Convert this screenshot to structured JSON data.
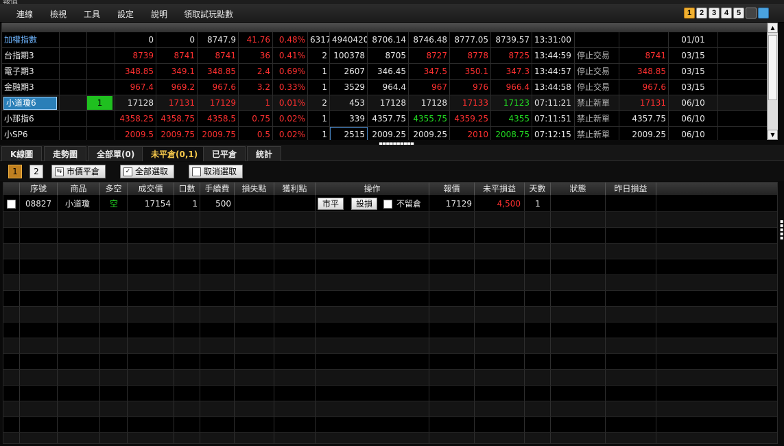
{
  "window": {
    "title": "報價"
  },
  "menu": [
    "連線",
    "檢視",
    "工具",
    "設定",
    "說明",
    "領取試玩點數"
  ],
  "layout_buttons": [
    "1",
    "2",
    "3",
    "4",
    "5"
  ],
  "quote": {
    "rows": [
      {
        "name": "加權指數",
        "c2": "",
        "c3": "",
        "bid": "0",
        "ask": "0",
        "last": "8747.9",
        "chg": "41.76",
        "pct": "0.48%",
        "vol": "6317",
        "total": "4940420",
        "ref": "8706.14",
        "open": "8746.48",
        "high": "8777.05",
        "low": "8739.57",
        "time": "13:31:00",
        "status": "",
        "settle": "",
        "date": "01/01"
      },
      {
        "name": "台指期3",
        "c2": "",
        "c3": "",
        "bid": "8739",
        "ask": "8741",
        "last": "8741",
        "chg": "36",
        "pct": "0.41%",
        "vol": "2",
        "total": "100378",
        "ref": "8705",
        "open": "8727",
        "high": "8778",
        "low": "8725",
        "time": "13:44:59",
        "status": "停止交易",
        "settle": "8741",
        "date": "03/15"
      },
      {
        "name": "電子期3",
        "c2": "",
        "c3": "",
        "bid": "348.85",
        "ask": "349.1",
        "last": "348.85",
        "chg": "2.4",
        "pct": "0.69%",
        "vol": "1",
        "total": "2607",
        "ref": "346.45",
        "open": "347.5",
        "high": "350.1",
        "low": "347.3",
        "time": "13:44:57",
        "status": "停止交易",
        "settle": "348.85",
        "date": "03/15"
      },
      {
        "name": "金融期3",
        "c2": "",
        "c3": "",
        "bid": "967.4",
        "ask": "969.2",
        "last": "967.6",
        "chg": "3.2",
        "pct": "0.33%",
        "vol": "1",
        "total": "3529",
        "ref": "964.4",
        "open": "967",
        "high": "976",
        "low": "966.4",
        "time": "13:44:58",
        "status": "停止交易",
        "settle": "967.6",
        "date": "03/15"
      },
      {
        "name": "小道瓊6",
        "c2": "",
        "c3": "1",
        "bid": "17128",
        "ask": "17131",
        "last": "17129",
        "chg": "1",
        "pct": "0.01%",
        "vol": "2",
        "total": "453",
        "ref": "17128",
        "open": "17128",
        "high": "17133",
        "low": "17123",
        "time": "07:11:21",
        "status": "禁止新單",
        "settle": "17131",
        "date": "06/10"
      },
      {
        "name": "小那指6",
        "c2": "",
        "c3": "",
        "bid": "4358.25",
        "ask": "4358.75",
        "last": "4358.5",
        "chg": "0.75",
        "pct": "0.02%",
        "vol": "1",
        "total": "339",
        "ref": "4357.75",
        "open": "4355.75",
        "high": "4359.25",
        "low": "4355",
        "time": "07:11:51",
        "status": "禁止新單",
        "settle": "4357.75",
        "date": "06/10"
      },
      {
        "name": "小SP6",
        "c2": "",
        "c3": "",
        "bid": "2009.5",
        "ask": "2009.75",
        "last": "2009.75",
        "chg": "0.5",
        "pct": "0.02%",
        "vol": "1",
        "total": "2515",
        "ref": "2009.25",
        "open": "2009.25",
        "high": "2010",
        "low": "2008.75",
        "time": "07:12:15",
        "status": "禁止新單",
        "settle": "2009.25",
        "date": "06/10"
      }
    ]
  },
  "tabs": [
    "K線圖",
    "走勢圖",
    "全部單(0)",
    "未平倉(0,1)",
    "已平倉",
    "統計"
  ],
  "active_tab": "未平倉(0,1)",
  "toolbar": {
    "pages": [
      "1",
      "2"
    ],
    "market_close": "市價平倉",
    "select_all": "全部選取",
    "deselect": "取消選取"
  },
  "positions": {
    "headers": [
      "序號",
      "商品",
      "多空",
      "成交價",
      "口數",
      "手續費",
      "損失點",
      "獲利點",
      "操作",
      "報價",
      "未平損益",
      "天數",
      "狀態",
      "昨日損益"
    ],
    "rows": [
      {
        "id": "08827",
        "product": "小道瓊",
        "side": "空",
        "price": "17154",
        "qty": "1",
        "fee": "500",
        "stop": "",
        "profit": "",
        "btn_close": "市平",
        "btn_set": "設損",
        "keep_label": "不留倉",
        "quote": "17129",
        "pnl": "4,500",
        "days": "1",
        "status": "",
        "yday": ""
      }
    ]
  },
  "colors": {
    "up": "#ff3030",
    "down": "#22dd22",
    "index": "#6aaef5",
    "active_tab": "#f3c64a"
  }
}
